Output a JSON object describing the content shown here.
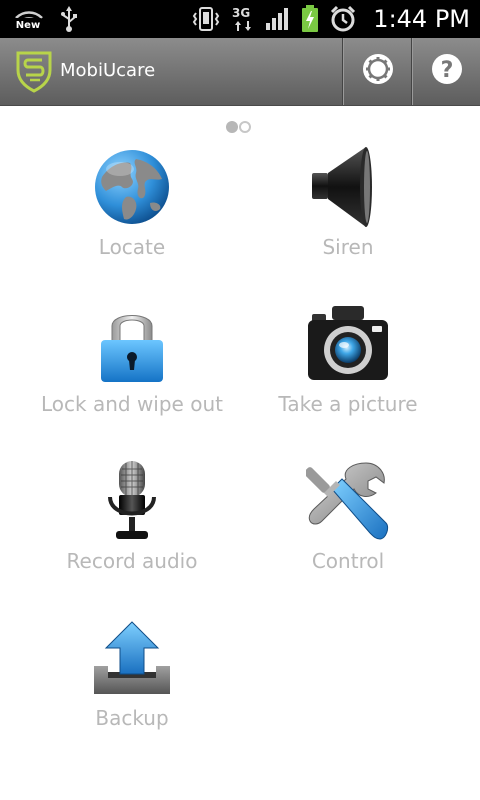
{
  "status_bar": {
    "time": "1:44 PM",
    "wifi_badge": "New",
    "network_type": "3G",
    "icons": [
      "wifi-new-icon",
      "usb-icon",
      "vibrate-icon",
      "network-3g-icon",
      "signal-icon",
      "battery-charging-icon",
      "alarm-icon"
    ]
  },
  "app_bar": {
    "title": "MobiUcare",
    "actions": [
      "settings-icon",
      "help-icon"
    ],
    "help_glyph": "?"
  },
  "pager": {
    "current_page": 1,
    "total_pages": 2
  },
  "features": [
    {
      "label": "Locate",
      "icon": "globe-icon"
    },
    {
      "label": "Siren",
      "icon": "speaker-icon"
    },
    {
      "label": "Lock and wipe out",
      "icon": "padlock-icon"
    },
    {
      "label": "Take a picture",
      "icon": "camera-icon"
    },
    {
      "label": "Record audio",
      "icon": "microphone-icon"
    },
    {
      "label": "Control",
      "icon": "tools-icon"
    },
    {
      "label": "Backup",
      "icon": "upload-icon"
    }
  ],
  "colors": {
    "label_gray": "#b8b8b8",
    "logo_green": "#b8d44a",
    "battery_green": "#7ac943"
  }
}
